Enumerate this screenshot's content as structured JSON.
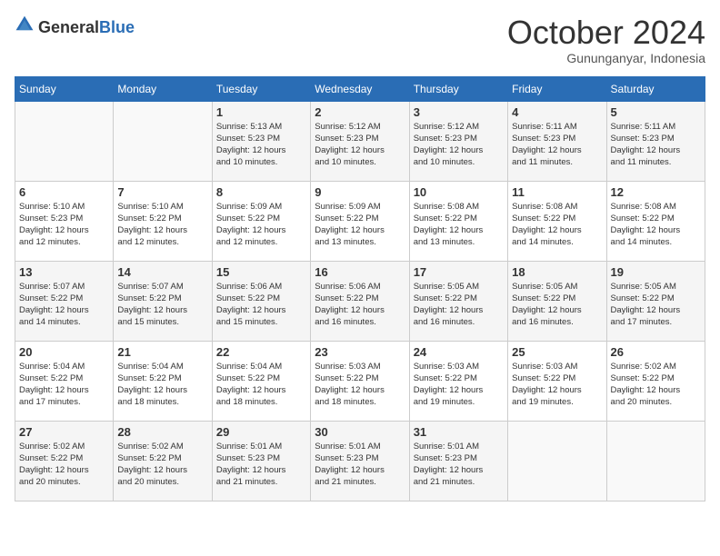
{
  "header": {
    "logo_general": "General",
    "logo_blue": "Blue",
    "month_title": "October 2024",
    "subtitle": "Gununganyar, Indonesia"
  },
  "days_of_week": [
    "Sunday",
    "Monday",
    "Tuesday",
    "Wednesday",
    "Thursday",
    "Friday",
    "Saturday"
  ],
  "weeks": [
    [
      {
        "day": "",
        "info": ""
      },
      {
        "day": "",
        "info": ""
      },
      {
        "day": "1",
        "info": "Sunrise: 5:13 AM\nSunset: 5:23 PM\nDaylight: 12 hours\nand 10 minutes."
      },
      {
        "day": "2",
        "info": "Sunrise: 5:12 AM\nSunset: 5:23 PM\nDaylight: 12 hours\nand 10 minutes."
      },
      {
        "day": "3",
        "info": "Sunrise: 5:12 AM\nSunset: 5:23 PM\nDaylight: 12 hours\nand 10 minutes."
      },
      {
        "day": "4",
        "info": "Sunrise: 5:11 AM\nSunset: 5:23 PM\nDaylight: 12 hours\nand 11 minutes."
      },
      {
        "day": "5",
        "info": "Sunrise: 5:11 AM\nSunset: 5:23 PM\nDaylight: 12 hours\nand 11 minutes."
      }
    ],
    [
      {
        "day": "6",
        "info": "Sunrise: 5:10 AM\nSunset: 5:23 PM\nDaylight: 12 hours\nand 12 minutes."
      },
      {
        "day": "7",
        "info": "Sunrise: 5:10 AM\nSunset: 5:22 PM\nDaylight: 12 hours\nand 12 minutes."
      },
      {
        "day": "8",
        "info": "Sunrise: 5:09 AM\nSunset: 5:22 PM\nDaylight: 12 hours\nand 12 minutes."
      },
      {
        "day": "9",
        "info": "Sunrise: 5:09 AM\nSunset: 5:22 PM\nDaylight: 12 hours\nand 13 minutes."
      },
      {
        "day": "10",
        "info": "Sunrise: 5:08 AM\nSunset: 5:22 PM\nDaylight: 12 hours\nand 13 minutes."
      },
      {
        "day": "11",
        "info": "Sunrise: 5:08 AM\nSunset: 5:22 PM\nDaylight: 12 hours\nand 14 minutes."
      },
      {
        "day": "12",
        "info": "Sunrise: 5:08 AM\nSunset: 5:22 PM\nDaylight: 12 hours\nand 14 minutes."
      }
    ],
    [
      {
        "day": "13",
        "info": "Sunrise: 5:07 AM\nSunset: 5:22 PM\nDaylight: 12 hours\nand 14 minutes."
      },
      {
        "day": "14",
        "info": "Sunrise: 5:07 AM\nSunset: 5:22 PM\nDaylight: 12 hours\nand 15 minutes."
      },
      {
        "day": "15",
        "info": "Sunrise: 5:06 AM\nSunset: 5:22 PM\nDaylight: 12 hours\nand 15 minutes."
      },
      {
        "day": "16",
        "info": "Sunrise: 5:06 AM\nSunset: 5:22 PM\nDaylight: 12 hours\nand 16 minutes."
      },
      {
        "day": "17",
        "info": "Sunrise: 5:05 AM\nSunset: 5:22 PM\nDaylight: 12 hours\nand 16 minutes."
      },
      {
        "day": "18",
        "info": "Sunrise: 5:05 AM\nSunset: 5:22 PM\nDaylight: 12 hours\nand 16 minutes."
      },
      {
        "day": "19",
        "info": "Sunrise: 5:05 AM\nSunset: 5:22 PM\nDaylight: 12 hours\nand 17 minutes."
      }
    ],
    [
      {
        "day": "20",
        "info": "Sunrise: 5:04 AM\nSunset: 5:22 PM\nDaylight: 12 hours\nand 17 minutes."
      },
      {
        "day": "21",
        "info": "Sunrise: 5:04 AM\nSunset: 5:22 PM\nDaylight: 12 hours\nand 18 minutes."
      },
      {
        "day": "22",
        "info": "Sunrise: 5:04 AM\nSunset: 5:22 PM\nDaylight: 12 hours\nand 18 minutes."
      },
      {
        "day": "23",
        "info": "Sunrise: 5:03 AM\nSunset: 5:22 PM\nDaylight: 12 hours\nand 18 minutes."
      },
      {
        "day": "24",
        "info": "Sunrise: 5:03 AM\nSunset: 5:22 PM\nDaylight: 12 hours\nand 19 minutes."
      },
      {
        "day": "25",
        "info": "Sunrise: 5:03 AM\nSunset: 5:22 PM\nDaylight: 12 hours\nand 19 minutes."
      },
      {
        "day": "26",
        "info": "Sunrise: 5:02 AM\nSunset: 5:22 PM\nDaylight: 12 hours\nand 20 minutes."
      }
    ],
    [
      {
        "day": "27",
        "info": "Sunrise: 5:02 AM\nSunset: 5:22 PM\nDaylight: 12 hours\nand 20 minutes."
      },
      {
        "day": "28",
        "info": "Sunrise: 5:02 AM\nSunset: 5:22 PM\nDaylight: 12 hours\nand 20 minutes."
      },
      {
        "day": "29",
        "info": "Sunrise: 5:01 AM\nSunset: 5:23 PM\nDaylight: 12 hours\nand 21 minutes."
      },
      {
        "day": "30",
        "info": "Sunrise: 5:01 AM\nSunset: 5:23 PM\nDaylight: 12 hours\nand 21 minutes."
      },
      {
        "day": "31",
        "info": "Sunrise: 5:01 AM\nSunset: 5:23 PM\nDaylight: 12 hours\nand 21 minutes."
      },
      {
        "day": "",
        "info": ""
      },
      {
        "day": "",
        "info": ""
      }
    ]
  ]
}
